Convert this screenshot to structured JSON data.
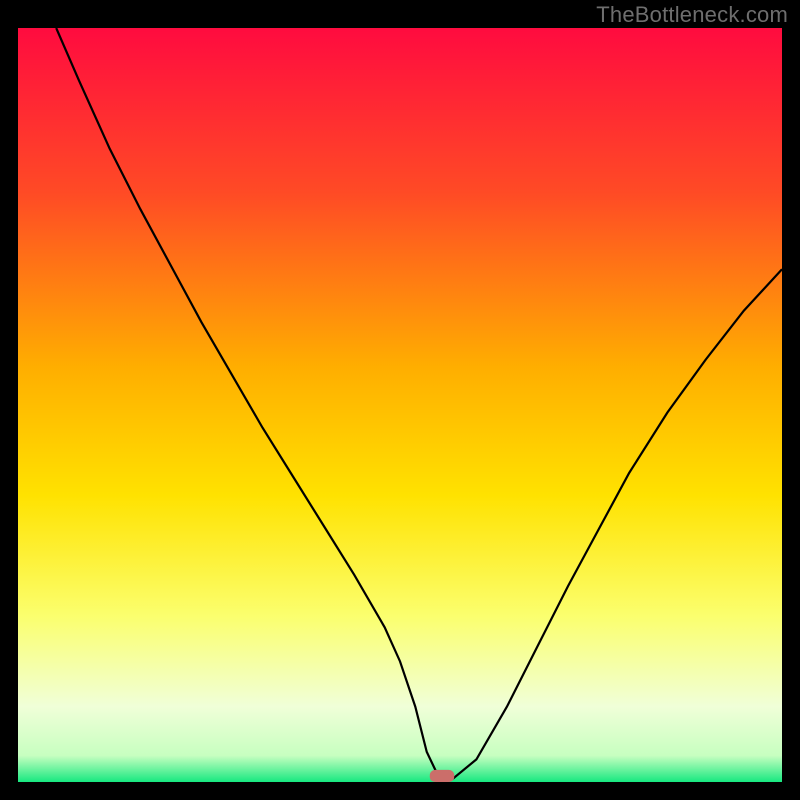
{
  "watermark": "TheBottleneck.com",
  "colors": {
    "top": "#ff0b3f",
    "mid_upper": "#ff7a1a",
    "mid": "#ffe200",
    "lower_yellow": "#faff70",
    "pale": "#f6ffd6",
    "green": "#17e880",
    "black": "#000000",
    "marker": "#cb6e6a"
  },
  "chart_data": {
    "type": "line",
    "title": "",
    "xlabel": "",
    "ylabel": "",
    "xlim": [
      0,
      100
    ],
    "ylim": [
      0,
      100
    ],
    "gradient_stops": [
      {
        "pos": 0.0,
        "color": "#ff0b3f"
      },
      {
        "pos": 0.22,
        "color": "#ff4b25"
      },
      {
        "pos": 0.45,
        "color": "#ffae00"
      },
      {
        "pos": 0.62,
        "color": "#ffe200"
      },
      {
        "pos": 0.78,
        "color": "#fbff6e"
      },
      {
        "pos": 0.9,
        "color": "#f0ffd8"
      },
      {
        "pos": 0.965,
        "color": "#c7ffc0"
      },
      {
        "pos": 1.0,
        "color": "#17e880"
      }
    ],
    "series": [
      {
        "name": "bottleneck-curve",
        "x": [
          5,
          8,
          12,
          16,
          20,
          24,
          28,
          32,
          36,
          40,
          44,
          48,
          50,
          52,
          53.5,
          55,
          57,
          60,
          64,
          68,
          72,
          76,
          80,
          85,
          90,
          95,
          100
        ],
        "y": [
          100,
          93,
          84,
          76,
          68.5,
          61,
          54,
          47,
          40.5,
          34,
          27.5,
          20.5,
          16,
          10,
          4,
          0.8,
          0.5,
          3,
          10,
          18,
          26,
          33.5,
          41,
          49,
          56,
          62.5,
          68
        ]
      }
    ],
    "marker": {
      "x": 55.5,
      "y": 0.8,
      "w": 3.2,
      "h": 1.6
    }
  }
}
